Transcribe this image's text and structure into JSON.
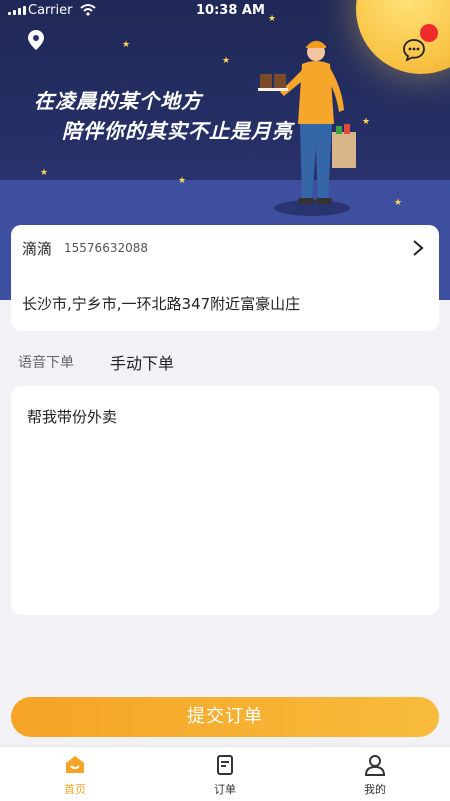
{
  "status_bar": {
    "carrier": "Carrier",
    "time": "10:38 AM"
  },
  "hero": {
    "slogan_line1": "在凌晨的某个地方",
    "slogan_line2": "陪伴你的其实不止是月亮"
  },
  "address_card": {
    "contact_name": "滴滴",
    "contact_phone": "15576632088",
    "address": "长沙市,宁乡市,一环北路347附近富豪山庄"
  },
  "order_mode_tabs": {
    "voice": "语音下单",
    "manual": "手动下单",
    "selected": "manual"
  },
  "order_note": {
    "text": "帮我带份外卖"
  },
  "submit_button": {
    "label": "提交订单"
  },
  "tab_bar": {
    "items": [
      {
        "label": "首页",
        "icon": "home-icon",
        "active": true
      },
      {
        "label": "订单",
        "icon": "order-icon",
        "active": false
      },
      {
        "label": "我的",
        "icon": "profile-icon",
        "active": false
      }
    ]
  },
  "colors": {
    "accent": "#f5a426",
    "hero_dark": "#1f2856",
    "hero_ground": "#3f4fa0",
    "alert_dot": "#ef2b2b"
  }
}
